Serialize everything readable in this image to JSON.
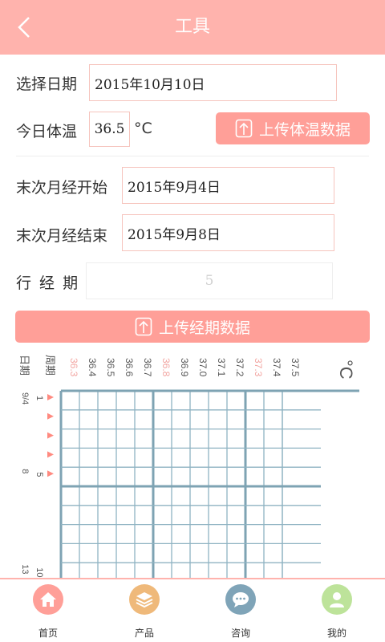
{
  "header": {
    "title": "工具"
  },
  "form": {
    "date_label": "选择日期",
    "date_value": "2015年10月10日",
    "temp_label": "今日体温",
    "temp_value": "36.5",
    "temp_unit": "°C",
    "upload_temp_label": "上传体温数据",
    "period_start_label": "末次月经开始",
    "period_start_value": "2015年9月4日",
    "period_end_label": "末次月经结束",
    "period_end_value": "2015年9月8日",
    "period_len_label": "行 经 期",
    "period_len_value": "5",
    "upload_period_label": "上传经期数据"
  },
  "chart_data": {
    "type": "table",
    "corner_top": "周期",
    "corner_bottom": "日期",
    "unit": "°C",
    "temps": [
      "36.3",
      "36.4",
      "36.5",
      "36.6",
      "36.7",
      "36.8",
      "36.9",
      "37.0",
      "37.1",
      "37.2",
      "37.3",
      "37.4",
      "37.5"
    ],
    "highlight_temps": [
      "36.3",
      "36.8",
      "37.3"
    ],
    "cycle_days": [
      "1",
      "5",
      "10"
    ],
    "dates": [
      "9/4",
      "8",
      "13"
    ],
    "period_markers": 5,
    "colors": {
      "grid": "#8fb3c2",
      "grid_bold": "#7ea3b3",
      "label": "#555555",
      "highlight": "#f2a4a0",
      "marker": "#ff8a80"
    }
  },
  "tabs": [
    {
      "label": "首页",
      "icon": "home-icon",
      "color": "#ff9f98"
    },
    {
      "label": "产品",
      "icon": "layers-icon",
      "color": "#efb97a"
    },
    {
      "label": "咨询",
      "icon": "chat-icon",
      "color": "#7fa4b8"
    },
    {
      "label": "我的",
      "icon": "user-icon",
      "color": "#bde39a"
    }
  ],
  "colors": {
    "accent": "#ffb3ad",
    "button": "#ff9f98"
  }
}
